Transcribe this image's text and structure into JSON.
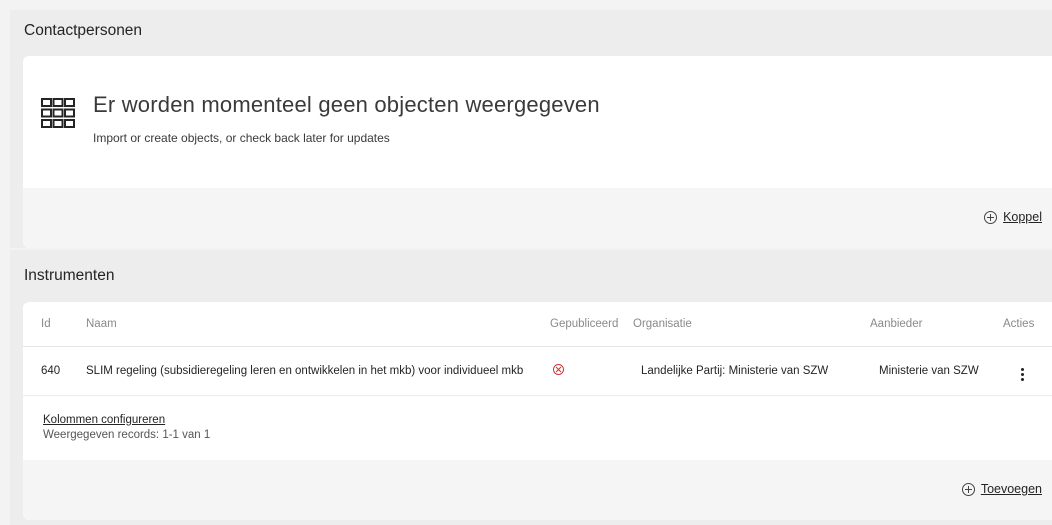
{
  "contacts": {
    "title": "Contactpersonen",
    "empty_title": "Er worden momenteel geen objecten weergegeven",
    "empty_subtitle": "Import or create objects, or check back later for updates",
    "action_label": "Koppel"
  },
  "instruments": {
    "title": "Instrumenten",
    "columns": {
      "id": "Id",
      "naam": "Naam",
      "gepubliceerd": "Gepubliceerd",
      "organisatie": "Organisatie",
      "aanbieder": "Aanbieder",
      "acties": "Acties"
    },
    "rows": [
      {
        "id": "640",
        "naam": "SLIM regeling (subsidieregeling leren en ontwikkelen in het mkb) voor individueel mkb",
        "gepubliceerd": "not-published",
        "organisatie": "Landelijke Partij: Ministerie van SZW",
        "aanbieder": "Ministerie van SZW"
      }
    ],
    "configure_columns_label": "Kolommen configureren",
    "records_label": "Weergegeven records: 1-1 van 1",
    "action_label": "Toevoegen"
  },
  "icons": {
    "empty_state": "grid-icon",
    "action": "add-circle-icon",
    "published_status": "dismiss-circle-icon",
    "row_menu": "more-vertical-icon"
  },
  "colors": {
    "status_error": "#d13438",
    "background": "#f3f3f4"
  }
}
